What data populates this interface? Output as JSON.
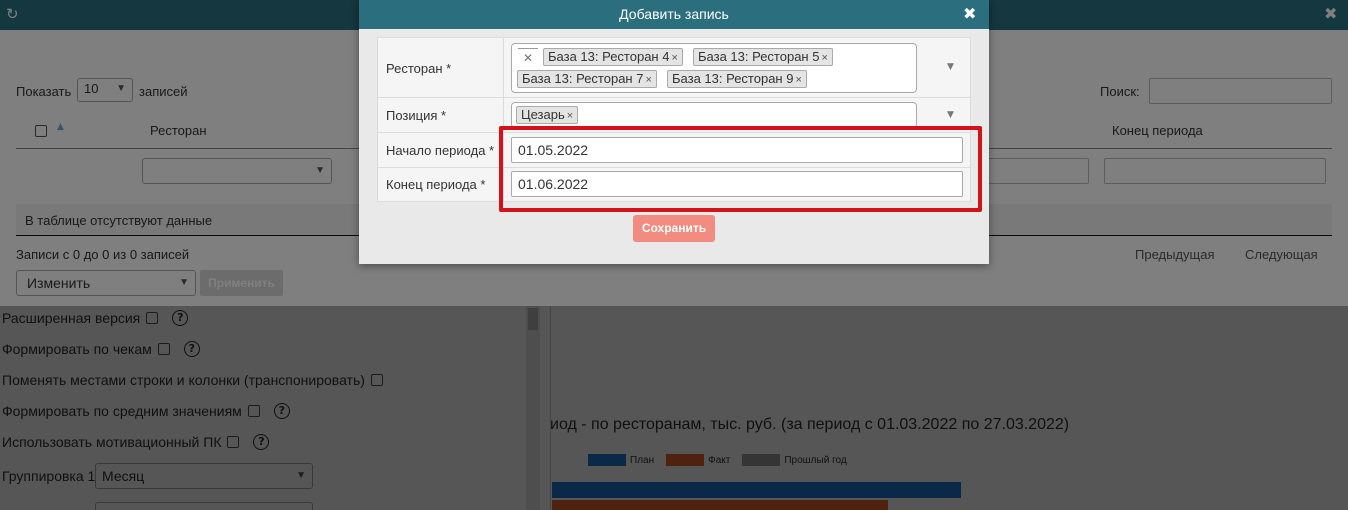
{
  "background": {
    "icons": {
      "refresh": "refresh-icon",
      "close": "close-icon"
    },
    "length_prefix": "Показать",
    "length_value": "10",
    "length_suffix": "записей",
    "search_label": "Поиск:",
    "columns": {
      "restaurant": "Ресторан",
      "period_end": "Конец периода"
    },
    "empty_table": "В таблице отсутствуют данные",
    "info": "Записи с 0 до 0 из 0 записей",
    "prev": "Предыдущая",
    "next": "Следующая",
    "bulk_action": "Изменить",
    "apply": "Применить",
    "options": [
      "Расширенная версия",
      "Формировать по чекам",
      "Поменять местами строки и колонки (транспонировать)",
      "Формировать по средним значениям",
      "Использовать мотивационный ПК"
    ],
    "grouping_label": "Группировка 1",
    "grouping_value": "Месяц",
    "chart_title": "иод - по ресторанам, тыс. руб. (за период с 01.03.2022 по 27.03.2022)",
    "legend": [
      "План",
      "Факт",
      "Прошлый год"
    ],
    "colors": {
      "plan": "#1f77d4",
      "fact": "#e8672a",
      "last_year": "#9e9e9e",
      "header": "#2b6f7e"
    }
  },
  "modal": {
    "title": "Добавить запись",
    "close_icon": "close-icon",
    "restaurant_label": "Ресторан *",
    "restaurant_tags": [
      "База 13: Ресторан 4",
      "База 13: Ресторан 5",
      "База 13: Ресторан 7",
      "База 13: Ресторан 9"
    ],
    "position_label": "Позиция *",
    "position_tags": [
      "Цезарь"
    ],
    "tag_remove": "×",
    "start_label": "Начало периода *",
    "start_value": "01.05.2022",
    "end_label": "Конец периода *",
    "end_value": "01.06.2022",
    "save": "Сохранить",
    "highlight_color": "#d2131a",
    "save_color": "#f28c80"
  }
}
